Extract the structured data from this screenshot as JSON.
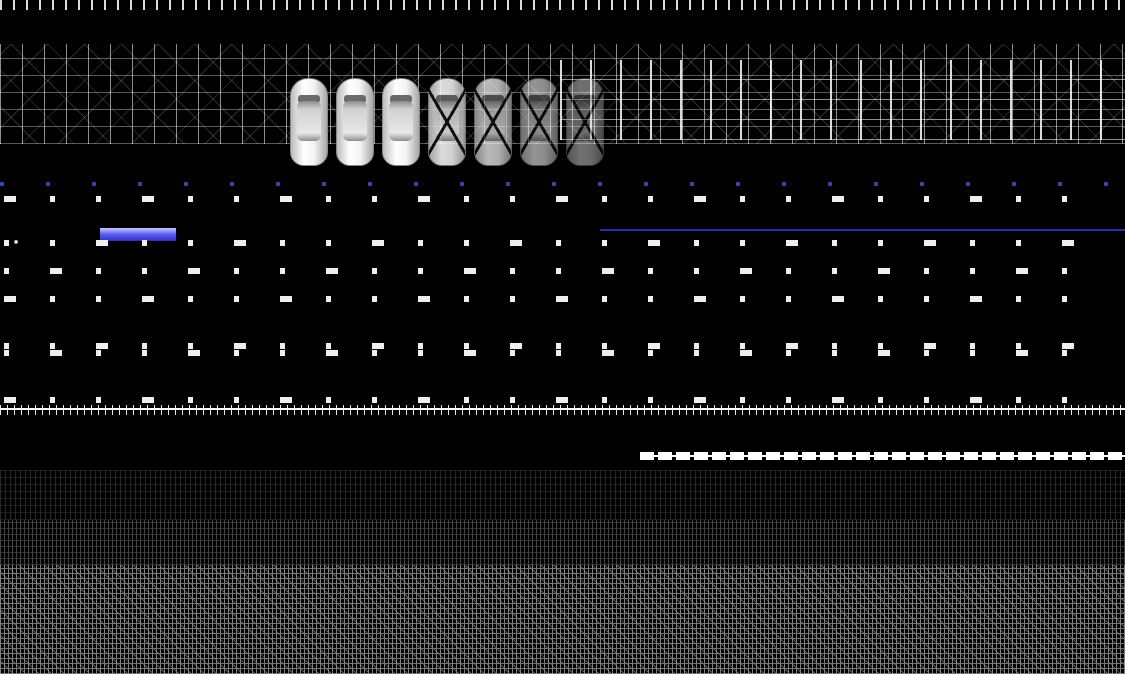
{
  "scene": {
    "car_sprites": [
      {
        "icon": "car-icon",
        "state": "intact"
      },
      {
        "icon": "car-icon",
        "state": "intact"
      },
      {
        "icon": "car-icon",
        "state": "intact"
      },
      {
        "icon": "car-icon",
        "state": "crossed"
      },
      {
        "icon": "car-icon",
        "state": "crossed"
      },
      {
        "icon": "car-icon",
        "state": "crossed"
      },
      {
        "icon": "car-icon",
        "state": "crossed"
      }
    ],
    "progress_bar": {
      "fill_fraction": 0.1,
      "stripe_fraction": 0.66,
      "color": "#5a5ef0"
    },
    "legible_text": "",
    "colors": {
      "background": "#000000",
      "accent_blue": "#2a2ea8",
      "sprite_white": "#f3f3f3"
    }
  }
}
